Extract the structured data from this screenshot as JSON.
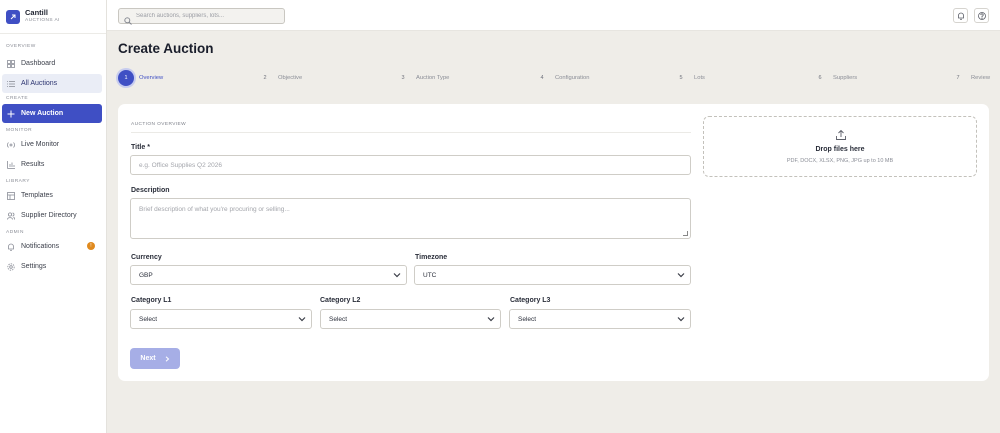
{
  "brand": {
    "name": "Cantill",
    "subtitle": "AUCTIONS AI"
  },
  "sidebar": {
    "sections": {
      "overview": "OVERVIEW",
      "create": "CREATE",
      "monitor": "MONITOR",
      "library": "LIBRARY",
      "admin": "ADMIN"
    },
    "items": {
      "dashboard": "Dashboard",
      "all_auctions": "All Auctions",
      "new_auction": "New Auction",
      "live_monitor": "Live Monitor",
      "results": "Results",
      "templates": "Templates",
      "supplier_directory": "Supplier Directory",
      "notifications": "Notifications",
      "notifications_badge": "!",
      "settings": "Settings"
    }
  },
  "topbar": {
    "search_placeholder": "Search auctions, suppliers, lots..."
  },
  "page": {
    "title": "Create Auction"
  },
  "steps": [
    {
      "num": "1",
      "label": "Overview"
    },
    {
      "num": "2",
      "label": "Objective"
    },
    {
      "num": "3",
      "label": "Auction Type"
    },
    {
      "num": "4",
      "label": "Configuration"
    },
    {
      "num": "5",
      "label": "Lots"
    },
    {
      "num": "6",
      "label": "Suppliers"
    },
    {
      "num": "7",
      "label": "Review"
    }
  ],
  "form": {
    "section_label": "AUCTION OVERVIEW",
    "title_label": "Title *",
    "title_placeholder": "e.g. Office Supplies Q2 2026",
    "description_label": "Description",
    "description_placeholder": "Brief description of what you're procuring or selling...",
    "currency_label": "Currency",
    "currency_value": "GBP",
    "timezone_label": "Timezone",
    "timezone_value": "UTC",
    "cat1_label": "Category L1",
    "cat1_value": "Select",
    "cat2_label": "Category L2",
    "cat2_value": "Select",
    "cat3_label": "Category L3",
    "cat3_value": "Select",
    "next_label": "Next"
  },
  "dropzone": {
    "title": "Drop files here",
    "subtitle": "PDF, DOCX, XLSX, PNG, JPG up to 10 MB"
  },
  "colors": {
    "accent": "#3f4fc4",
    "badge": "#e08a1e",
    "background": "#efede8"
  }
}
